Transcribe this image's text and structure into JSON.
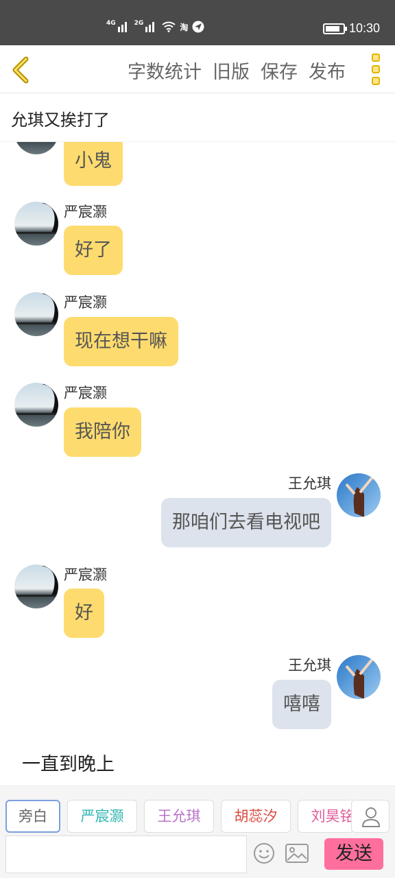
{
  "status_bar": {
    "net1": "4G",
    "net2": "2G",
    "app_badge": "淘",
    "time": "10:30",
    "battery_level": 0.85
  },
  "toolbar": {
    "word_count": "字数统计",
    "old_version": "旧版",
    "save": "保存",
    "publish": "发布"
  },
  "story": {
    "title": "允琪又挨打了"
  },
  "messages": [
    {
      "side": "left",
      "speaker": "",
      "text": "小鬼"
    },
    {
      "side": "left",
      "speaker": "严宸灏",
      "text": "好了"
    },
    {
      "side": "left",
      "speaker": "严宸灏",
      "text": "现在想干嘛"
    },
    {
      "side": "left",
      "speaker": "严宸灏",
      "text": "我陪你"
    },
    {
      "side": "right",
      "speaker": "王允琪",
      "text": "那咱们去看电视吧"
    },
    {
      "side": "left",
      "speaker": "严宸灏",
      "text": "好"
    },
    {
      "side": "right",
      "speaker": "王允琪",
      "text": "嘻嘻"
    }
  ],
  "narration": "一直到晚上",
  "composer": {
    "characters": [
      {
        "label": "旁白",
        "color": "#666666"
      },
      {
        "label": "严宸灏",
        "color": "#2fb6b2"
      },
      {
        "label": "王允琪",
        "color": "#b872c8"
      },
      {
        "label": "胡蕊汐",
        "color": "#d94a3e"
      },
      {
        "label": "刘昊铭",
        "color": "#e05c9a"
      }
    ],
    "input_placeholder": "",
    "send_label": "发送"
  },
  "colors": {
    "left_bubble": "#fddb6e",
    "right_bubble": "#dde3ec",
    "send_button": "#ff6f9d",
    "accent_yellow": "#e0b600"
  }
}
